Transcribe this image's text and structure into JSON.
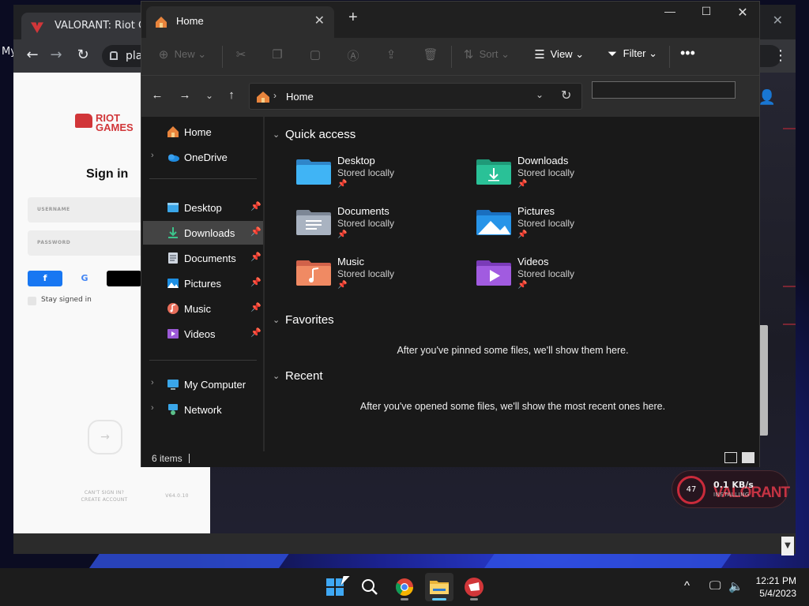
{
  "browser": {
    "tab_title": "VALORANT: Riot Games",
    "bookmark_fragment": "My",
    "address_fragment": "pla"
  },
  "riot": {
    "logo_line1": "RIOT",
    "logo_line2": "GAMES",
    "title": "Sign in",
    "username_placeholder": "USERNAME",
    "password_placeholder": "PASSWORD",
    "stay_signed_in": "Stay signed in",
    "footer_line1": "CAN'T SIGN IN?",
    "footer_line2": "CREATE ACCOUNT",
    "version": "V64.0.10"
  },
  "install": {
    "percent": "47",
    "speed": "0.1 KB/s",
    "status": "INSTALLING",
    "logo": "VALORANT"
  },
  "explorer": {
    "tab_title": "Home",
    "commands": {
      "new": "New",
      "sort": "Sort",
      "view": "View",
      "filter": "Filter"
    },
    "address": "Home",
    "nav": {
      "home": "Home",
      "onedrive": "OneDrive",
      "desktop": "Desktop",
      "downloads": "Downloads",
      "documents": "Documents",
      "pictures": "Pictures",
      "music": "Music",
      "videos": "Videos",
      "my_computer": "My Computer",
      "network": "Network"
    },
    "sections": {
      "quick_access": "Quick access",
      "favorites": "Favorites",
      "recent": "Recent"
    },
    "quick_access": [
      {
        "name": "Desktop",
        "status": "Stored locally"
      },
      {
        "name": "Downloads",
        "status": "Stored locally"
      },
      {
        "name": "Documents",
        "status": "Stored locally"
      },
      {
        "name": "Pictures",
        "status": "Stored locally"
      },
      {
        "name": "Music",
        "status": "Stored locally"
      },
      {
        "name": "Videos",
        "status": "Stored locally"
      }
    ],
    "favorites_empty": "After you've pinned some files, we'll show them here.",
    "recent_empty": "After you've opened some files, we'll show the most recent ones here.",
    "status_items": "6 items"
  },
  "taskbar": {
    "time": "12:21 PM",
    "date": "5/4/2023"
  },
  "colors": {
    "explorer_bg": "#191919",
    "accent": "#60cdff",
    "riot_red": "#d13639"
  }
}
